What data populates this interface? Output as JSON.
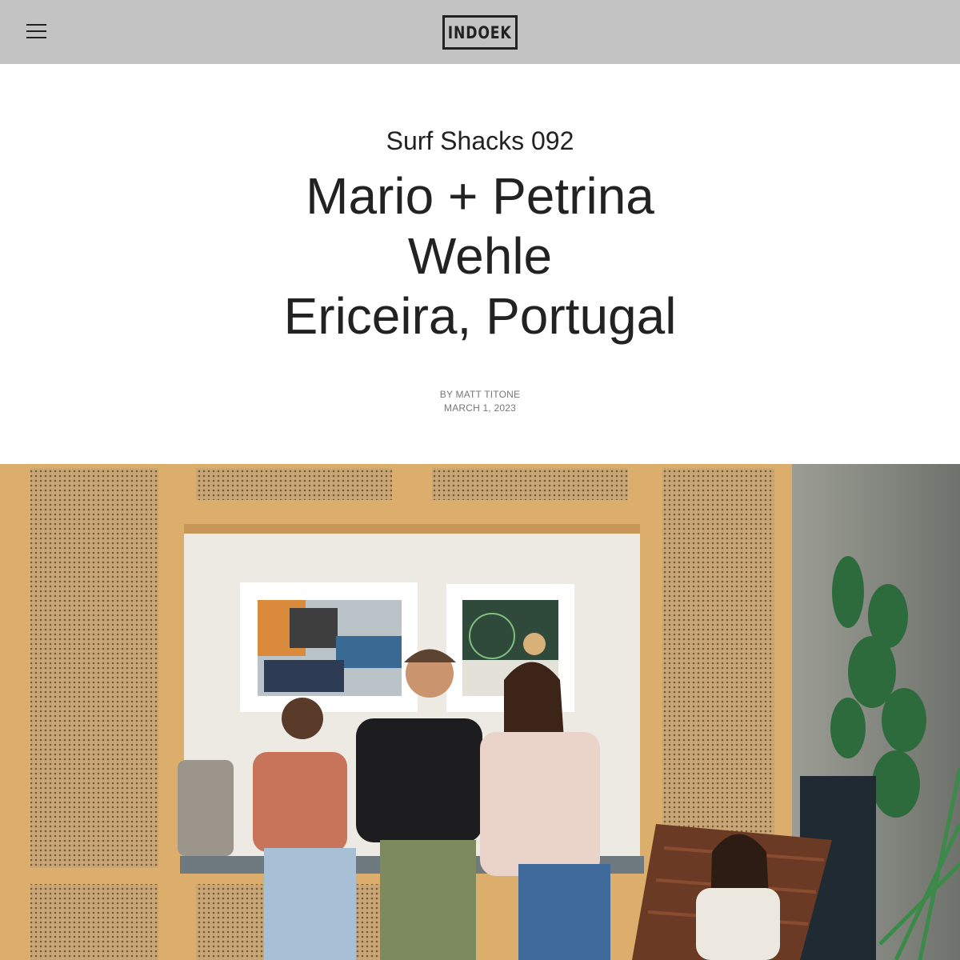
{
  "header": {
    "logo_text": "INDOEK",
    "menu_icon": "hamburger-menu-icon"
  },
  "article": {
    "series": "Surf Shacks 092",
    "title_lines": [
      "Mario + Petrina",
      "Wehle",
      "Ericeira, Portugal"
    ],
    "author": "BY MATT TITONE",
    "date": "MARCH 1, 2023"
  },
  "colors": {
    "header_bg": "#c3c3c3",
    "text": "#222222",
    "meta_text": "#777777"
  }
}
